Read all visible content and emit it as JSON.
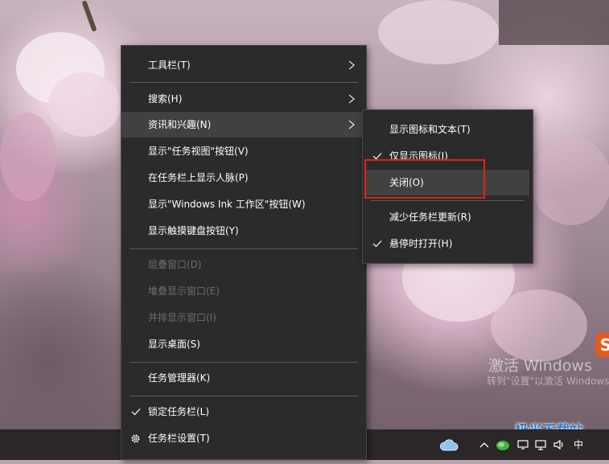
{
  "desktop": {
    "activation_title": "激活 Windows",
    "activation_sub": "转到\"设置\"以激活 Windows。",
    "watermark_site": "极光下载站",
    "watermark_logo": "S"
  },
  "taskbar_menu": {
    "items": [
      {
        "label": "工具栏(T)",
        "submenu": true
      },
      {
        "label": "搜索(H)",
        "submenu": true
      },
      {
        "label": "资讯和兴趣(N)",
        "submenu": true,
        "highlighted": true
      },
      {
        "label": "显示\"任务视图\"按钮(V)"
      },
      {
        "label": "在任务栏上显示人脉(P)"
      },
      {
        "label": "显示\"Windows Ink 工作区\"按钮(W)"
      },
      {
        "label": "显示触摸键盘按钮(Y)"
      },
      {
        "label": "层叠窗口(D)",
        "disabled": true
      },
      {
        "label": "堆叠显示窗口(E)",
        "disabled": true
      },
      {
        "label": "并排显示窗口(I)",
        "disabled": true
      },
      {
        "label": "显示桌面(S)"
      },
      {
        "label": "任务管理器(K)"
      },
      {
        "label": "锁定任务栏(L)",
        "checked": true
      },
      {
        "label": "任务栏设置(T)",
        "icon": "gear-icon"
      }
    ]
  },
  "news_submenu": {
    "items": [
      {
        "label": "显示图标和文本(T)"
      },
      {
        "label": "仅显示图标(I)",
        "checked": true
      },
      {
        "label": "关闭(O)",
        "highlighted": true,
        "annotated": true
      },
      {
        "label": "减少任务栏更新(R)"
      },
      {
        "label": "悬停时打开(H)",
        "checked": true
      }
    ]
  },
  "tray": {
    "weather_icon": "cloud-icon",
    "chevron_icon": "chevron-up-icon",
    "ime_label": "中",
    "icons": [
      "network-icon",
      "volume-icon"
    ]
  },
  "colors": {
    "menu_bg": "#2b2b2b",
    "highlight_bg": "#414141",
    "annotation_red": "#e0221b"
  }
}
